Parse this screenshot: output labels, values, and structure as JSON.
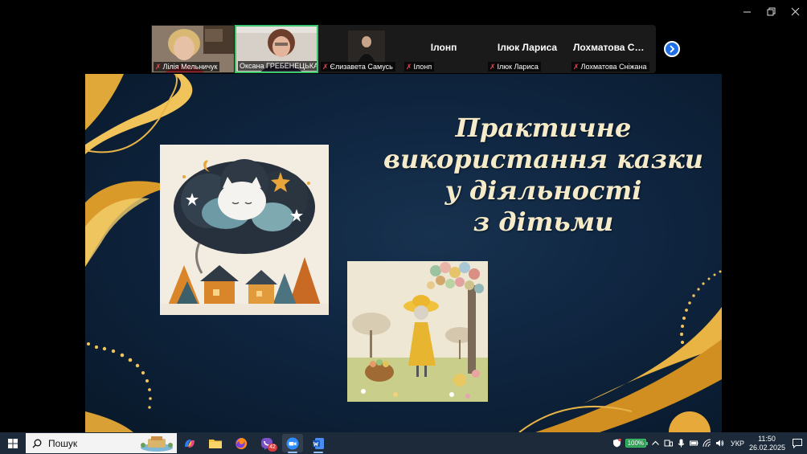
{
  "window": {
    "minimize_icon": "minimize-icon",
    "restore_icon": "restore-icon",
    "close_icon": "close-icon"
  },
  "participants": [
    {
      "name": "Лілія Мельничук",
      "video": true,
      "muted": true,
      "active": false
    },
    {
      "name": "Оксана ГРЕБЕНЕЦЬКА ЗД...",
      "video": true,
      "muted": false,
      "active": true
    },
    {
      "name": "Єлизавета Самусь",
      "video": true,
      "muted": true,
      "active": false
    },
    {
      "name": "Ілонп",
      "display": "Ілонп",
      "video": false,
      "muted": true,
      "active": false
    },
    {
      "name": "Ілюк Лариса",
      "display": "Ілюк Лариса",
      "video": false,
      "muted": true,
      "active": false
    },
    {
      "name": "Лохматова Сніжана",
      "display": "Лохматова Сні...",
      "video": false,
      "muted": true,
      "active": false
    }
  ],
  "slide": {
    "title_lines": [
      "Практичне",
      "використання казки",
      "у діяльності",
      "з дітьми"
    ]
  },
  "taskbar": {
    "search_label": "Пошук",
    "zoom_badge": "42",
    "battery_text": "100%",
    "language": "УКР",
    "time": "11:50",
    "date": "26.02.2025"
  },
  "colors": {
    "active_speaker": "#3ec46d",
    "slide_bg": "#0f2540",
    "title_text": "#f6ebc9",
    "gold": "#d9a032"
  }
}
